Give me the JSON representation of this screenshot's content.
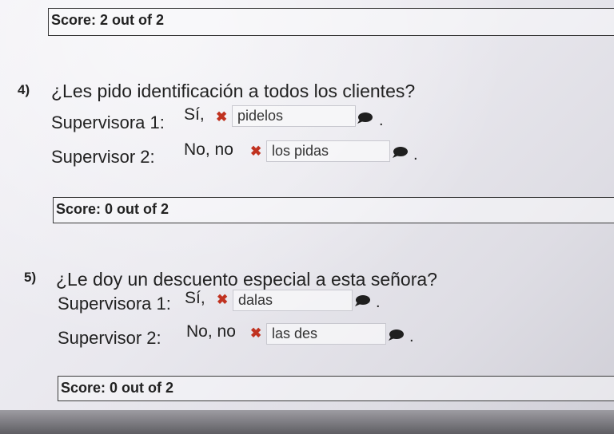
{
  "score_top": "Score: 2 out of 2",
  "questions": [
    {
      "number": "4)",
      "question": "¿Les pido identificación a todos los clientes?",
      "answers": [
        {
          "label": "Supervisora 1:",
          "prefix": "Sí,",
          "input": "pidelos",
          "status": "incorrect"
        },
        {
          "label": "Supervisor 2:",
          "prefix": "No, no",
          "input": "los pidas",
          "status": "incorrect"
        }
      ],
      "score": "Score: 0 out of 2"
    },
    {
      "number": "5)",
      "question": "¿Le doy un descuento especial a esta señora?",
      "answers": [
        {
          "label": "Supervisora 1:",
          "prefix": "Sí,",
          "input": "dalas",
          "status": "incorrect"
        },
        {
          "label": "Supervisor 2:",
          "prefix": "No, no",
          "input": "las des",
          "status": "incorrect"
        }
      ],
      "score": "Score: 0 out of 2"
    }
  ],
  "icons": {
    "incorrect": "x-mark-icon",
    "comment": "comment-bubble-icon"
  },
  "colors": {
    "incorrect": "#c03220",
    "text": "#222222"
  }
}
